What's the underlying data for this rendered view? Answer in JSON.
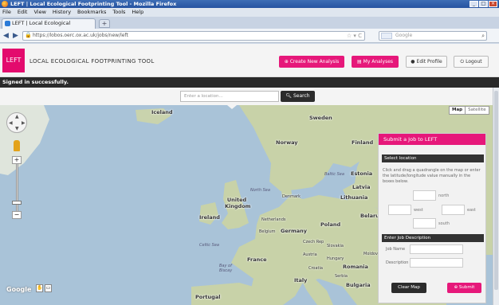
{
  "window": {
    "title": "LEFT | Local Ecological Footprinting Tool - Mozilla Firefox",
    "controls": [
      "_",
      "□",
      "×"
    ]
  },
  "menubar": [
    "File",
    "Edit",
    "View",
    "History",
    "Bookmarks",
    "Tools",
    "Help"
  ],
  "tab": {
    "label": "LEFT | Local Ecological Footprinting Tool",
    "new_tab": "+"
  },
  "nav": {
    "back": "◀",
    "forward": "▶",
    "url": "https://lobos.oerc.ox.ac.uk/jobs/new/left",
    "search_placeholder": "Google"
  },
  "app": {
    "logo": "LEFT",
    "title": "LOCAL ECOLOGICAL FOOTPRINTING TOOL",
    "buttons": {
      "create": "Create New Analysis",
      "analyses": "My Analyses",
      "profile": "Edit Profile",
      "logout": "Logout"
    }
  },
  "flash": "Signed in successfully.",
  "map": {
    "location_placeholder": "Enter a location...",
    "search_button": "Search",
    "type_map": "Map",
    "type_satellite": "Satellite",
    "attribution": "Google",
    "labels": {
      "iceland": "Iceland",
      "sweden": "Sweden",
      "norway": "Norway",
      "finland": "Finland",
      "estonia": "Estonia",
      "baltic_sea": "Baltic Sea",
      "latvia": "Latvia",
      "north_sea": "North Sea",
      "denmark": "Denmark",
      "lithuania": "Lithuania",
      "united_kingdom": "United Kingdom",
      "ireland": "Ireland",
      "netherlands": "Netherlands",
      "poland": "Poland",
      "belarus": "Belarus",
      "belgium": "Belgium",
      "germany": "Germany",
      "czech_rep": "Czech Rep",
      "slovakia": "Slovakia",
      "celtic_sea": "Celtic Sea",
      "austria": "Austria",
      "hungary": "Hungary",
      "moldova": "Moldov",
      "bay_of_biscay": "Bay of Biscay",
      "france": "France",
      "croatia": "Croatia",
      "romania": "Romania",
      "serbia": "Serbia",
      "italy": "Italy",
      "bulgaria": "Bulgaria",
      "portugal": "Portugal"
    }
  },
  "panel": {
    "title": "Submit a Job to LEFT",
    "select_location": "Select location",
    "help": "Click and drag a quadrangle on the map or enter the latitude/longitude value manually in the boxes below.",
    "north": "north",
    "west": "west",
    "east": "east",
    "south": "south",
    "enter_description": "Enter Job Description",
    "job_name": "Job Name",
    "description": "Description",
    "clear_map": "Clear Map",
    "submit": "Submit"
  },
  "colors": {
    "accent": "#e6187a",
    "sea": "#a9c3d8",
    "land": "#c8d2a8",
    "dark": "#2c2c2c"
  }
}
